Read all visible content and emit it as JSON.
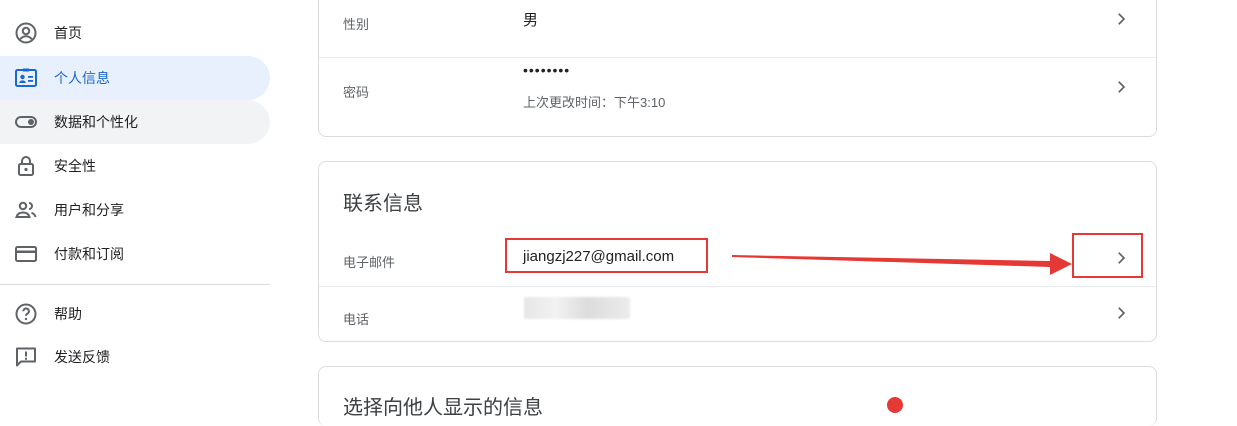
{
  "sidebar": {
    "items": [
      {
        "label": "首页",
        "icon": "account-circle-icon"
      },
      {
        "label": "个人信息",
        "icon": "id-card-icon"
      },
      {
        "label": "数据和个性化",
        "icon": "toggle-icon"
      },
      {
        "label": "安全性",
        "icon": "lock-icon"
      },
      {
        "label": "用户和分享",
        "icon": "people-icon"
      },
      {
        "label": "付款和订阅",
        "icon": "credit-card-icon"
      },
      {
        "label": "帮助",
        "icon": "help-circle-icon"
      },
      {
        "label": "发送反馈",
        "icon": "feedback-icon"
      }
    ],
    "active_index": 1
  },
  "basic_info": {
    "gender": {
      "label": "性别",
      "value": "男"
    },
    "password": {
      "label": "密码",
      "value": "••••••••",
      "sub": "上次更改时间：下午3:10"
    }
  },
  "contact_info": {
    "title": "联系信息",
    "email": {
      "label": "电子邮件",
      "value": "jiangzj227@gmail.com"
    },
    "phone": {
      "label": "电话"
    }
  },
  "next_card": {
    "title": "选择向他人显示的信息"
  },
  "colors": {
    "accent": "#1967d2",
    "active_bg": "#e8f0fe",
    "annotation_red": "#e53935"
  }
}
